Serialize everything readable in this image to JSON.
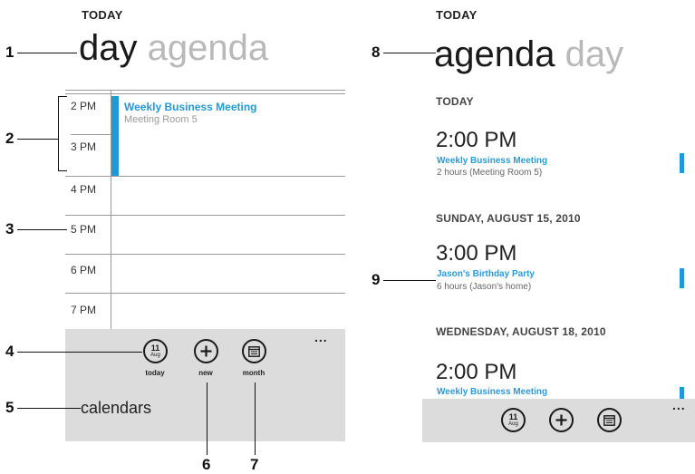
{
  "day_view": {
    "today_label": "TODAY",
    "pivot_active": "day",
    "pivot_inactive": "agenda",
    "hours": [
      "2 PM",
      "3 PM",
      "4 PM",
      "5 PM",
      "6 PM",
      "7 PM"
    ],
    "appointment": {
      "title": "Weekly Business Meeting",
      "location": "Meeting Room 5"
    },
    "app_bar": {
      "buttons": [
        {
          "label": "today",
          "icon_day": "11",
          "icon_month": "Aug"
        },
        {
          "label": "new"
        },
        {
          "label": "month"
        }
      ],
      "ellipsis": "...",
      "menu_item": "calendars"
    }
  },
  "agenda_view": {
    "today_label": "TODAY",
    "pivot_active": "agenda",
    "pivot_inactive": "day",
    "sections": [
      {
        "heading": "TODAY",
        "time": "2:00 PM",
        "title": "Weekly Business Meeting",
        "detail": "2 hours (Meeting Room 5)"
      },
      {
        "heading": "SUNDAY, AUGUST 15, 2010",
        "time": "3:00 PM",
        "title": "Jason's Birthday Party",
        "detail": "6 hours (Jason's home)"
      },
      {
        "heading": "WEDNESDAY, AUGUST 18, 2010",
        "time": "2:00 PM",
        "title": "Weekly Business Meeting",
        "detail": ""
      }
    ],
    "app_bar": {
      "icon_day": "11",
      "icon_month": "Aug",
      "ellipsis": "..."
    }
  },
  "callouts": [
    "1",
    "2",
    "3",
    "4",
    "5",
    "6",
    "7",
    "8",
    "9"
  ],
  "colors": {
    "accent": "#1f9ad6",
    "app_bar": "#dcdcdc",
    "inactive_pivot": "#b9b9b9"
  }
}
